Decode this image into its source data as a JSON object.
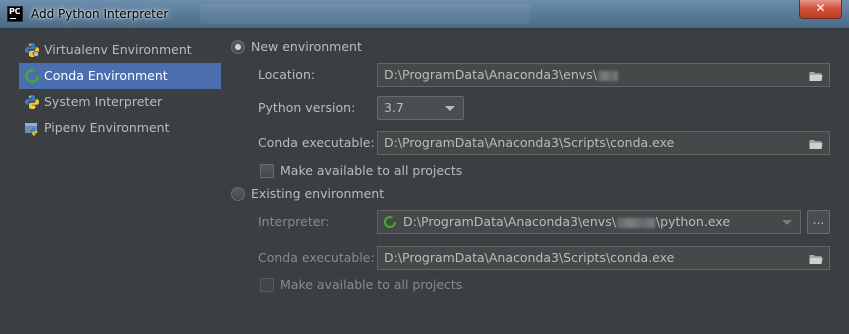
{
  "window": {
    "title": "Add Python Interpreter",
    "close_label": "✕"
  },
  "sidebar": {
    "items": [
      {
        "label": "Virtualenv Environment",
        "icon": "virtualenv-python-icon"
      },
      {
        "label": "Conda Environment",
        "icon": "conda-icon",
        "selected": true
      },
      {
        "label": "System Interpreter",
        "icon": "python-icon"
      },
      {
        "label": "Pipenv Environment",
        "icon": "pipenv-icon"
      }
    ]
  },
  "new_env": {
    "radio_label": "New environment",
    "checked": true,
    "location_label": "Location:",
    "location_value": "D:\\ProgramData\\Anaconda3\\envs\\",
    "python_version_label": "Python version:",
    "python_version_value": "3.7",
    "conda_exec_label": "Conda executable:",
    "conda_exec_value": "D:\\ProgramData\\Anaconda3\\Scripts\\conda.exe",
    "make_available_label": "Make available to all projects"
  },
  "existing_env": {
    "radio_label": "Existing environment",
    "checked": false,
    "interpreter_label": "Interpreter:",
    "interpreter_value_prefix": "D:\\ProgramData\\Anaconda3\\envs\\",
    "interpreter_value_suffix": "\\python.exe",
    "browse_label": "...",
    "conda_exec_label": "Conda executable:",
    "conda_exec_value": "D:\\ProgramData\\Anaconda3\\Scripts\\conda.exe",
    "make_available_label": "Make available to all projects"
  },
  "colors": {
    "background": "#3c3f41",
    "selection": "#4b6eaf",
    "text": "#bbbbbb",
    "conda_green": "#43b02a"
  }
}
